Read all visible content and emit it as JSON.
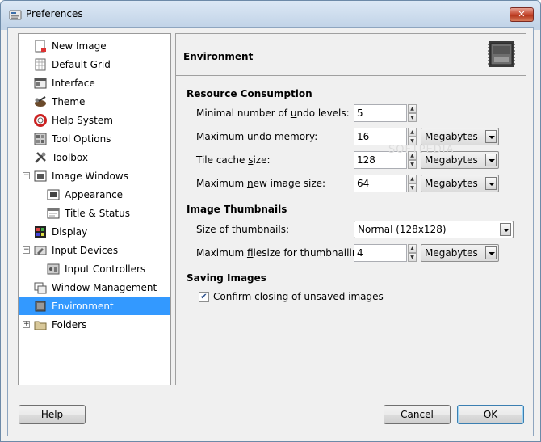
{
  "window": {
    "title": "Preferences",
    "close_glyph": "✕"
  },
  "tree": {
    "items": [
      {
        "label": "New Image",
        "icon": "new-image-icon"
      },
      {
        "label": "Default Grid",
        "icon": "grid-icon"
      },
      {
        "label": "Interface",
        "icon": "interface-icon"
      },
      {
        "label": "Theme",
        "icon": "theme-icon"
      },
      {
        "label": "Help System",
        "icon": "lifebuoy-icon"
      },
      {
        "label": "Tool Options",
        "icon": "tool-options-icon"
      },
      {
        "label": "Toolbox",
        "icon": "toolbox-icon"
      },
      {
        "label": "Image Windows",
        "icon": "image-window-icon",
        "expander": "−"
      },
      {
        "label": "Appearance",
        "icon": "appearance-icon"
      },
      {
        "label": "Title & Status",
        "icon": "title-status-icon"
      },
      {
        "label": "Display",
        "icon": "display-icon"
      },
      {
        "label": "Input Devices",
        "icon": "input-devices-icon",
        "expander": "−"
      },
      {
        "label": "Input Controllers",
        "icon": "input-controllers-icon"
      },
      {
        "label": "Window Management",
        "icon": "window-management-icon"
      },
      {
        "label": "Environment",
        "icon": "environment-icon"
      },
      {
        "label": "Folders",
        "icon": "folders-icon",
        "expander": "+"
      }
    ],
    "selected": "Environment"
  },
  "panel": {
    "title": "Environment",
    "icon": "ram-icon",
    "resource": {
      "title": "Resource Consumption",
      "undo_levels": {
        "pre": "Minimal number of ",
        "ul": "u",
        "post": "ndo levels:",
        "value": "5"
      },
      "undo_memory": {
        "pre": "Maximum undo ",
        "ul": "m",
        "post": "emory:",
        "value": "16",
        "unit": "Megabytes"
      },
      "tile_cache": {
        "pre": "Tile cache ",
        "ul": "s",
        "post": "ize:",
        "value": "128",
        "unit": "Megabytes"
      },
      "new_image": {
        "pre": "Maximum ",
        "ul": "n",
        "post": "ew image size:",
        "value": "64",
        "unit": "Megabytes"
      }
    },
    "thumbnails": {
      "title": "Image Thumbnails",
      "size": {
        "pre": "Size of ",
        "ul": "t",
        "post": "humbnails:",
        "value": "Normal (128x128)"
      },
      "filesize": {
        "pre": "Maximum ",
        "ul": "f",
        "post": "ilesize for thumbnailing:",
        "value": "4",
        "unit": "Megabytes"
      }
    },
    "saving": {
      "title": "Saving Images",
      "confirm": {
        "pre": "Confirm closing of unsa",
        "ul": "v",
        "post": "ed images",
        "checked": true,
        "check_glyph": "✔"
      }
    }
  },
  "buttons": {
    "help": {
      "ul": "H",
      "post": "elp"
    },
    "cancel": {
      "ul": "C",
      "post": "ancel"
    },
    "ok": {
      "ul": "O",
      "post": "K"
    }
  },
  "watermark": "SOFTPEDIA"
}
